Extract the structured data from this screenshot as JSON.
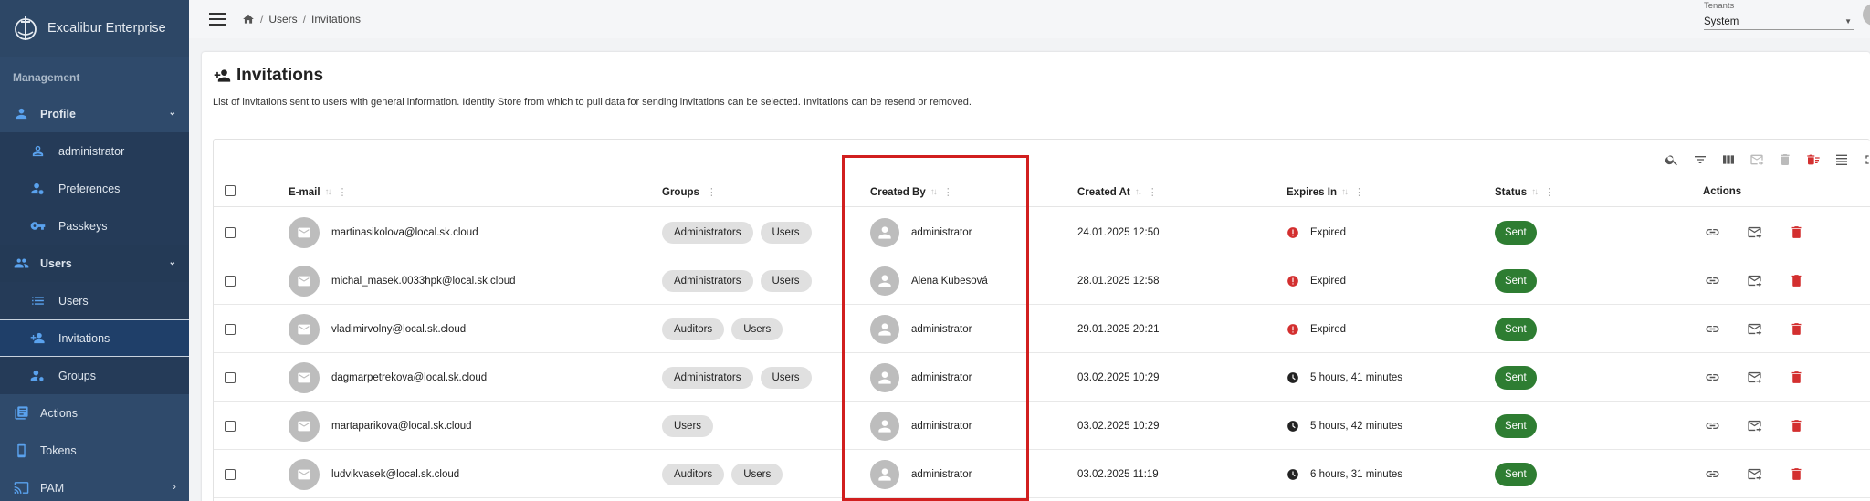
{
  "brand": {
    "name": "Excalibur Enterprise"
  },
  "sidebar": {
    "section": "Management",
    "items": [
      {
        "label": "Profile",
        "type": "top",
        "icon": "person-icon",
        "expanded": true
      },
      {
        "label": "administrator",
        "type": "sub",
        "icon": "person-outline-icon"
      },
      {
        "label": "Preferences",
        "type": "sub",
        "icon": "person-gear-icon"
      },
      {
        "label": "Passkeys",
        "type": "sub",
        "icon": "key-icon"
      },
      {
        "label": "Users",
        "type": "top",
        "icon": "people-icon",
        "expanded": true
      },
      {
        "label": "Users",
        "type": "sub",
        "icon": "list-icon"
      },
      {
        "label": "Invitations",
        "type": "sub",
        "icon": "person-add-icon",
        "active": true
      },
      {
        "label": "Groups",
        "type": "sub",
        "icon": "group-gear-icon"
      },
      {
        "label": "Actions",
        "type": "top",
        "icon": "library-icon"
      },
      {
        "label": "Tokens",
        "type": "top",
        "icon": "phone-icon"
      },
      {
        "label": "PAM",
        "type": "top",
        "icon": "cast-icon"
      }
    ]
  },
  "breadcrumb": {
    "items": [
      "Users",
      "Invitations"
    ]
  },
  "tenant": {
    "label": "Tenants",
    "value": "System"
  },
  "page": {
    "title": "Invitations",
    "description": "List of invitations sent to users with general information. Identity Store from which to pull data for sending invitations can be selected. Invitations can be resend or removed."
  },
  "table": {
    "columns": {
      "email": "E-mail",
      "groups": "Groups",
      "created_by": "Created By",
      "created_at": "Created At",
      "expires_in": "Expires In",
      "status": "Status",
      "actions": "Actions"
    },
    "rows": [
      {
        "email": "martinasikolova@local.sk.cloud",
        "groups": [
          "Administrators",
          "Users"
        ],
        "created_by": "administrator",
        "created_at": "24.01.2025 12:50",
        "expires_in": "Expired",
        "expired": true,
        "status": "Sent"
      },
      {
        "email": "michal_masek.0033hpk@local.sk.cloud",
        "groups": [
          "Administrators",
          "Users"
        ],
        "created_by": "Alena Kubesová",
        "created_at": "28.01.2025 12:58",
        "expires_in": "Expired",
        "expired": true,
        "status": "Sent"
      },
      {
        "email": "vladimirvolny@local.sk.cloud",
        "groups": [
          "Auditors",
          "Users"
        ],
        "created_by": "administrator",
        "created_at": "29.01.2025 20:21",
        "expires_in": "Expired",
        "expired": true,
        "status": "Sent"
      },
      {
        "email": "dagmarpetrekova@local.sk.cloud",
        "groups": [
          "Administrators",
          "Users"
        ],
        "created_by": "administrator",
        "created_at": "03.02.2025 10:29",
        "expires_in": "5 hours, 41 minutes",
        "expired": false,
        "status": "Sent"
      },
      {
        "email": "martaparikova@local.sk.cloud",
        "groups": [
          "Users"
        ],
        "created_by": "administrator",
        "created_at": "03.02.2025 10:29",
        "expires_in": "5 hours, 42 minutes",
        "expired": false,
        "status": "Sent"
      },
      {
        "email": "ludvikvasek@local.sk.cloud",
        "groups": [
          "Auditors",
          "Users"
        ],
        "created_by": "administrator",
        "created_at": "03.02.2025 11:19",
        "expires_in": "6 hours, 31 minutes",
        "expired": false,
        "status": "Sent"
      }
    ]
  },
  "colors": {
    "sidebar": "#2f4a6b",
    "accent": "#5aa2ee",
    "sent": "#2e7d32",
    "danger": "#d32f2f",
    "highlight": "#d11f1f"
  }
}
